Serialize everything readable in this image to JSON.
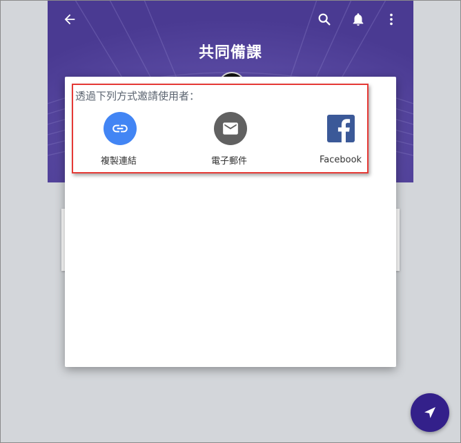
{
  "header": {
    "title": "共同備課",
    "icons": [
      "back-arrow-icon",
      "search-icon",
      "bell-icon",
      "more-vert-icon"
    ]
  },
  "dialog": {
    "invite_label": "透過下列方式邀請使用者：",
    "options": [
      {
        "label": "複製連結",
        "icon": "link-icon",
        "color": "#4285f4"
      },
      {
        "label": "電子郵件",
        "icon": "mail-icon",
        "color": "#616161"
      },
      {
        "label": "Facebook",
        "icon": "facebook-icon",
        "color": "#3b5998"
      }
    ]
  },
  "fab": {
    "icon": "send-icon",
    "color": "#33208a"
  },
  "colors": {
    "header_bg": "#4a3a92",
    "highlight_border": "#e53935",
    "page_bg": "#d3d6da"
  }
}
